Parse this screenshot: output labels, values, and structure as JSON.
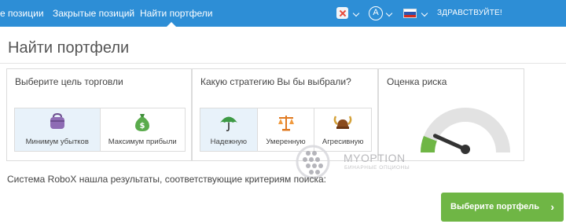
{
  "nav": {
    "items": [
      {
        "label": "е позиции"
      },
      {
        "label": "Закрытые позиций"
      },
      {
        "label": "Найти портфели"
      }
    ],
    "avatar_letter": "A",
    "greeting": "ЗДРАВСТВУЙТЕ!",
    "colors": {
      "bar": "#2d8ed6",
      "close": "#e64b3c"
    }
  },
  "page": {
    "title": "Найти портфели"
  },
  "goal": {
    "title": "Выберите цель торговли",
    "options": [
      {
        "label": "Минимум убытков",
        "icon": "wallet-icon",
        "selected": true
      },
      {
        "label": "Максимум прибыли",
        "icon": "money-bag-icon",
        "selected": false
      }
    ]
  },
  "strategy": {
    "title": "Какую стратегию Вы бы выбрали?",
    "options": [
      {
        "label": "Надежную",
        "icon": "umbrella-icon",
        "selected": true
      },
      {
        "label": "Умеренную",
        "icon": "scales-icon",
        "selected": false
      },
      {
        "label": "Агресивную",
        "icon": "viking-helmet-icon",
        "selected": false
      }
    ]
  },
  "risk": {
    "title": "Оценка риска",
    "level": 0.12,
    "colors": {
      "track": "#e2e2e2",
      "fill": "#6fb645",
      "needle": "#333333"
    }
  },
  "result": {
    "text": "Система RoboX нашла результаты, соответствующие критериям поиска:"
  },
  "cta": {
    "label": "Выберите портфель",
    "arrow": "›",
    "color": "#6fb645"
  },
  "watermark": {
    "brand": "MYOPTION",
    "sub": "БИНАРНЫЕ ОПЦИОНЫ"
  }
}
